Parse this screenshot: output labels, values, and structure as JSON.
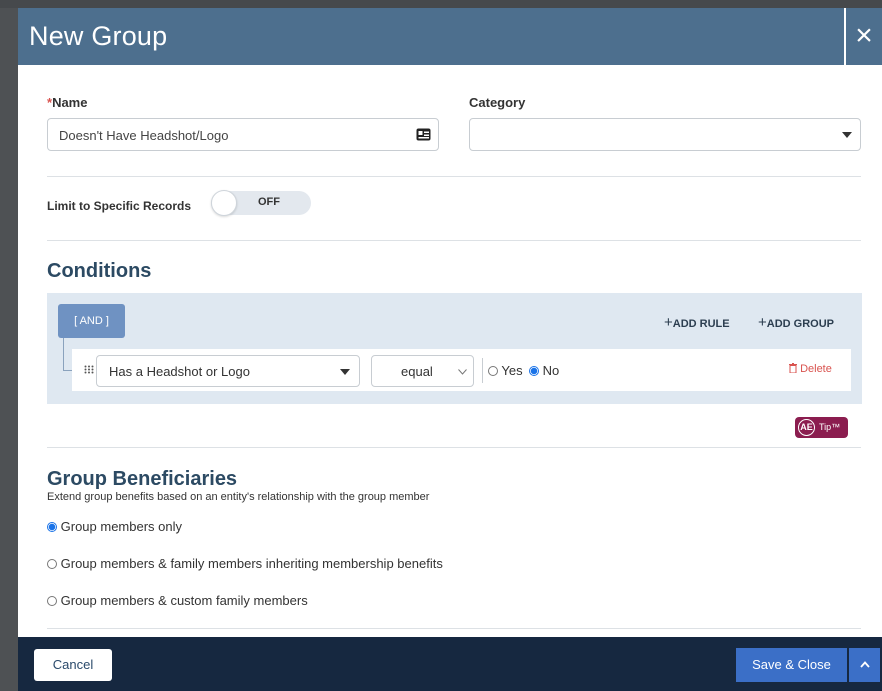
{
  "modal": {
    "title": "New Group",
    "close_icon": "×"
  },
  "form": {
    "name_label": "Name",
    "required_mark": "*",
    "name_value": "Doesn't Have Headshot/Logo",
    "category_label": "Category",
    "category_value": "",
    "limit_label": "Limit to Specific Records",
    "limit_toggle_state": "OFF"
  },
  "conditions": {
    "heading": "Conditions",
    "operator_label": "[ AND ]",
    "add_rule_label": "ADD RULE",
    "add_group_label": "ADD GROUP",
    "plus": "+",
    "rule": {
      "field": "Has a Headshot or Logo",
      "operator": "equal",
      "value_options": [
        "Yes",
        "No"
      ],
      "selected_value": "No",
      "delete_label": "Delete"
    },
    "tip_badge": "AE",
    "tip_label": "Tip™"
  },
  "beneficiaries": {
    "heading": "Group Beneficiaries",
    "subtitle": "Extend group benefits based on an entity's relationship with the group member",
    "options": [
      "Group members only",
      "Group members & family members inheriting membership benefits",
      "Group members & custom family members"
    ],
    "selected_index": 0
  },
  "footer": {
    "cancel_label": "Cancel",
    "save_label": "Save & Close"
  },
  "colors": {
    "header_bg": "#4d6f8e",
    "footer_bg": "#162840",
    "primary_button": "#3b6fc7",
    "conditions_bg": "#dfe8f1",
    "delete_red": "#d9534f",
    "tip_bg": "#8b1d4f"
  },
  "icons": {
    "close": "close-icon",
    "contact_card": "contact-card-icon",
    "dropdown": "caret-down-icon",
    "drag": "drag-handle-icon",
    "trash": "trash-icon",
    "chevron_up": "chevron-up-icon"
  }
}
